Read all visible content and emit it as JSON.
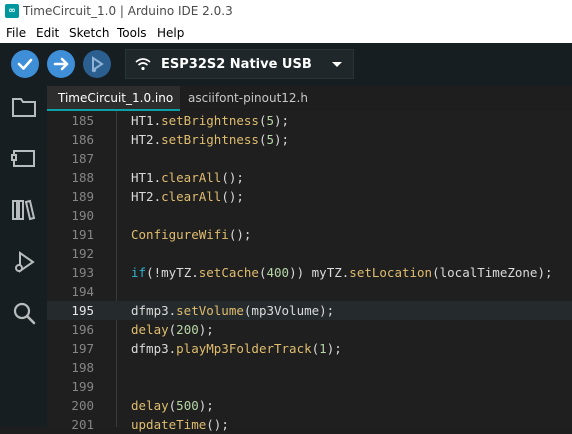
{
  "window": {
    "title": "TimeCircuit_1.0 | Arduino IDE 2.0.3"
  },
  "menu": [
    "File",
    "Edit",
    "Sketch",
    "Tools",
    "Help"
  ],
  "toolbar": {
    "board_name": "ESP32S2 Native USB",
    "verify_icon": "checkmark-icon",
    "upload_icon": "arrow-right-icon",
    "debug_icon": "debug-icon"
  },
  "sidebar": {
    "icons": [
      "folder-icon",
      "board-icon",
      "library-icon",
      "debug-icon",
      "search-icon"
    ]
  },
  "tabs": [
    {
      "label": "TimeCircuit_1.0.ino",
      "active": true
    },
    {
      "label": "asciifont-pinout12.h",
      "active": false
    }
  ],
  "editor": {
    "current_line": "195",
    "lines": [
      {
        "num": "185",
        "text": "HT1.setBrightness(5);"
      },
      {
        "num": "186",
        "text": "HT2.setBrightness(5);"
      },
      {
        "num": "187",
        "text": ""
      },
      {
        "num": "188",
        "text": "HT1.clearAll();"
      },
      {
        "num": "189",
        "text": "HT2.clearAll();"
      },
      {
        "num": "190",
        "text": ""
      },
      {
        "num": "191",
        "text": "ConfigureWifi();"
      },
      {
        "num": "192",
        "text": ""
      },
      {
        "num": "193",
        "text": "if(!myTZ.setCache(400)) myTZ.setLocation(localTimeZone);"
      },
      {
        "num": "194",
        "text": ""
      },
      {
        "num": "195",
        "text": "dfmp3.setVolume(mp3Volume);"
      },
      {
        "num": "196",
        "text": "delay(200);"
      },
      {
        "num": "197",
        "text": "dfmp3.playMp3FolderTrack(1);"
      },
      {
        "num": "198",
        "text": ""
      },
      {
        "num": "199",
        "text": ""
      },
      {
        "num": "200",
        "text": "delay(500);"
      },
      {
        "num": "201",
        "text": "updateTime();"
      }
    ]
  },
  "colors": {
    "accent": "#0ca1a6",
    "button": "#3f8ed8",
    "toolbar_bg": "#171e21",
    "editor_bg": "#1f1f1f"
  }
}
